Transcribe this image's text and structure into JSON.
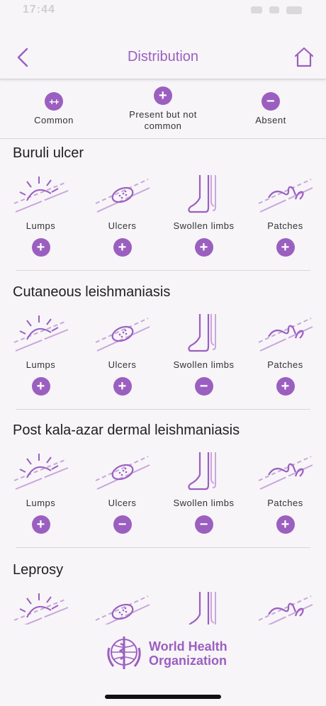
{
  "status": {
    "time": "17:44"
  },
  "nav": {
    "title": "Distribution"
  },
  "legend": [
    {
      "symbol": "++",
      "label": "Common"
    },
    {
      "symbol": "+",
      "label": "Present but not\ncommon"
    },
    {
      "symbol": "−",
      "label": "Absent"
    }
  ],
  "lesion_labels": [
    "Lumps",
    "Ulcers",
    "Swollen limbs",
    "Patches"
  ],
  "sections": [
    {
      "title": "Buruli ulcer",
      "values": [
        "+",
        "+",
        "+",
        "+"
      ]
    },
    {
      "title": "Cutaneous leishmaniasis",
      "values": [
        "+",
        "+",
        "−",
        "+"
      ]
    },
    {
      "title": "Post kala-azar dermal leishmaniasis",
      "values": [
        "+",
        "−",
        "−",
        "+"
      ]
    },
    {
      "title": "Leprosy",
      "values": []
    }
  ],
  "footer": {
    "org_line1": "World Health",
    "org_line2": "Organization"
  },
  "colors": {
    "accent": "#9b5fc0",
    "icon_light": "#c9a6dc"
  }
}
